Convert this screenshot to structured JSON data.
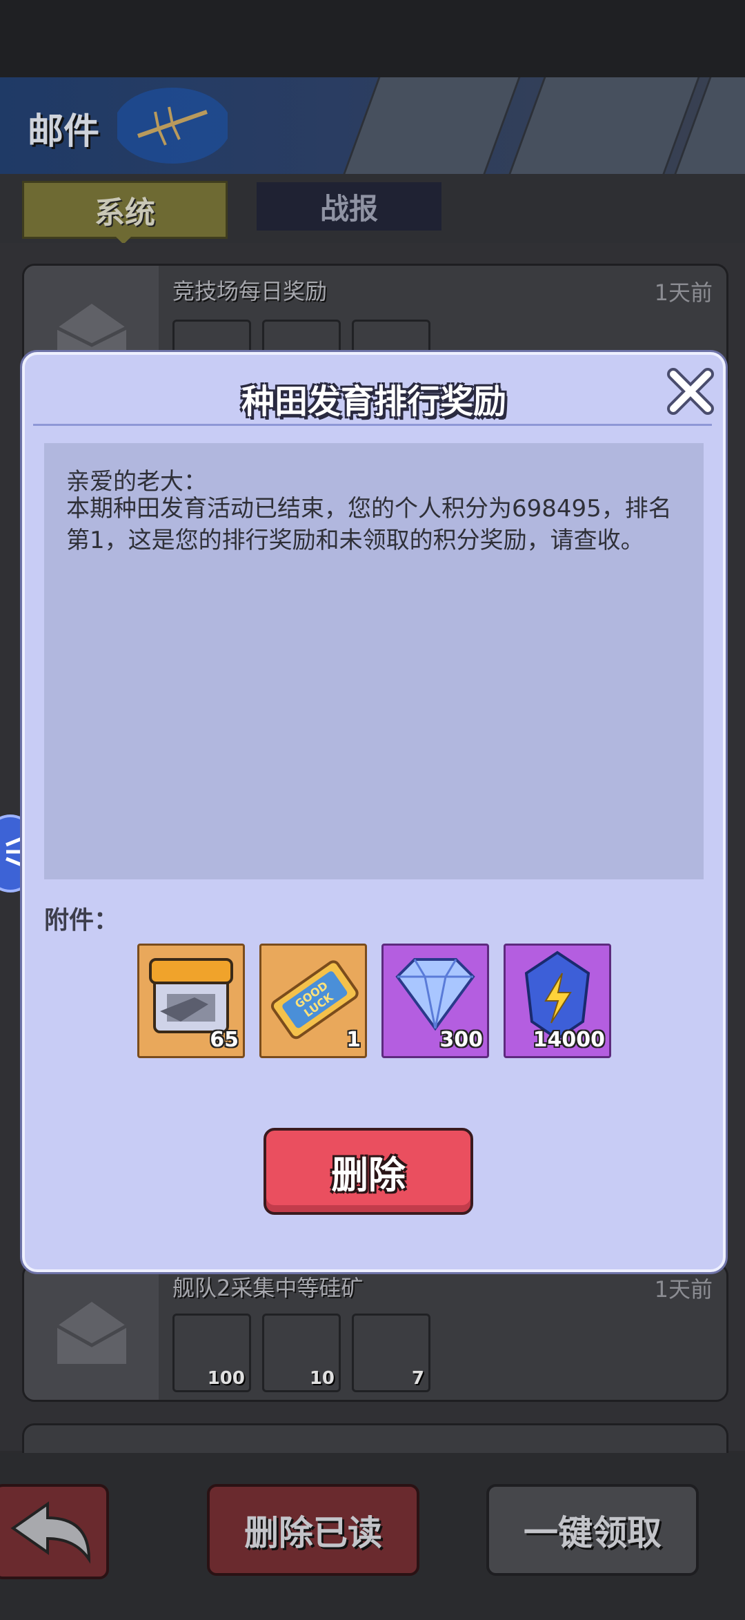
{
  "header": {
    "title": "邮件"
  },
  "tabs": [
    {
      "label": "系统",
      "active": true
    },
    {
      "label": "战报",
      "active": false
    }
  ],
  "mail_list": [
    {
      "title": "竞技场每日奖励",
      "time": "1天前"
    },
    {
      "title": "舰队2采集中等硅矿",
      "time": "1天前",
      "attachments": [
        {
          "count": "100"
        },
        {
          "count": "10"
        },
        {
          "count": "7"
        }
      ]
    }
  ],
  "modal": {
    "title": "种田发育排行奖励",
    "greeting": "亲爱的老大：",
    "body": "本期种田发育活动已结束，您的个人积分为698495，排名第1，这是您的排行奖励和未领取的积分奖励，请查收。",
    "attachments_label": "附件：",
    "attachments": [
      {
        "icon": "supply-crate-icon",
        "count": "65"
      },
      {
        "icon": "good-luck-ticket-icon",
        "count": "1"
      },
      {
        "icon": "diamond-icon",
        "count": "300"
      },
      {
        "icon": "energy-crystal-icon",
        "count": "14000"
      }
    ],
    "delete_label": "删除"
  },
  "footer": {
    "delete_read_label": "删除已读",
    "claim_all_label": "一键领取"
  },
  "colors": {
    "modal_bg": "#c8ccf5",
    "delete_button": "#ea4f5f",
    "active_tab": "#6e6a33"
  }
}
